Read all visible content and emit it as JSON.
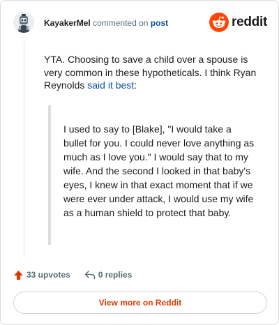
{
  "header": {
    "username": "KayakerMel",
    "commented_on": "commented on",
    "post_link": "post",
    "brand": "reddit"
  },
  "comment": {
    "body_prefix": "YTA. Choosing to save a child over a spouse is very common in these hypotheticals. I think Ryan Reynolds ",
    "body_link": "said it best",
    "body_suffix": ":",
    "quote": "I used to say to [Blake], \"I would take a bullet for you. I could never love anything as much as I love you.\" I would say that to my wife. And the second I looked in that baby's eyes, I knew in that exact moment that if we were ever under attack, I would use my wife as a human shield to protect that baby."
  },
  "actions": {
    "upvotes": "33 upvotes",
    "replies": "0 replies"
  },
  "footer": {
    "view_more": "View more on Reddit"
  },
  "colors": {
    "brand_orange": "#ff4500",
    "link_blue": "#0a4f9e",
    "upvote_orange": "#d93a00",
    "meta_gray": "#576f76"
  },
  "icons": {
    "avatar": "user-avatar",
    "brand": "reddit-logo-icon",
    "upvote": "upvote-arrow-icon",
    "reply": "reply-arrow-icon"
  }
}
